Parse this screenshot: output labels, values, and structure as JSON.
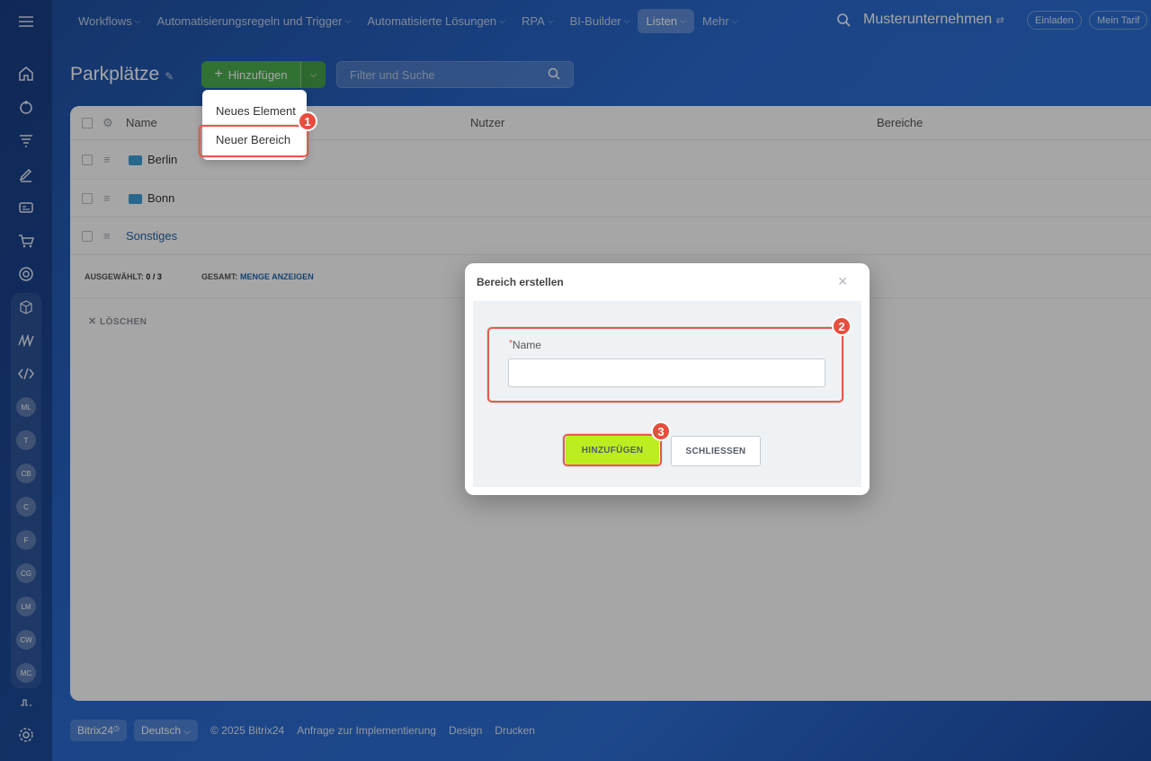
{
  "nav": {
    "items": [
      {
        "label": "Workflows",
        "chevron": true,
        "active": false
      },
      {
        "label": "Automatisierungsregeln und Trigger",
        "chevron": true,
        "active": false
      },
      {
        "label": "Automatisierte Lösungen",
        "chevron": true,
        "active": false
      },
      {
        "label": "RPA",
        "chevron": true,
        "active": false
      },
      {
        "label": "BI-Builder",
        "chevron": true,
        "active": false
      },
      {
        "label": "Listen",
        "chevron": true,
        "active": true
      },
      {
        "label": "Mehr",
        "chevron": true,
        "active": false
      }
    ],
    "company": "Musterunternehmen",
    "invite_label": "Einladen",
    "plan_label": "Mein Tarif"
  },
  "sidebar": {
    "avatars": [
      "ML",
      "T",
      "CB",
      "C",
      "F",
      "CG",
      "LM",
      "CW",
      "MC"
    ]
  },
  "page": {
    "title": "Parkplätze",
    "add_label": "Hinzufügen",
    "filter_placeholder": "Filter und Suche"
  },
  "table": {
    "columns": [
      "Name",
      "Nutzer",
      "Bereiche"
    ],
    "rows": [
      {
        "name": "Berlin",
        "type": "folder"
      },
      {
        "name": "Bonn",
        "type": "folder"
      },
      {
        "name": "Sonstiges",
        "type": "item"
      }
    ],
    "selected_label": "AUSGEWÄHLT:",
    "selected_value": "0 / 3",
    "total_label": "GESAMT:",
    "total_link": "MENGE ANZEIGEN",
    "delete_label": "LÖSCHEN"
  },
  "dropdown": {
    "items": [
      "Neues Element",
      "Neuer Bereich"
    ]
  },
  "modal": {
    "title": "Bereich erstellen",
    "required_mark": "*",
    "field_label": "Name",
    "field_value": "",
    "add_button": "HINZUFÜGEN",
    "close_button": "SCHLIESSEN"
  },
  "badges": [
    "1",
    "2",
    "3"
  ],
  "footer": {
    "brand": "Bitrix24",
    "language": "Deutsch",
    "copyright": "© 2025 Bitrix24",
    "links": [
      "Anfrage zur Implementierung",
      "Design",
      "Drucken"
    ]
  },
  "colors": {
    "accent_green": "#4caf50",
    "primary_button": "#bbed21",
    "highlight": "#e8574b",
    "link_blue": "#2067b0"
  }
}
